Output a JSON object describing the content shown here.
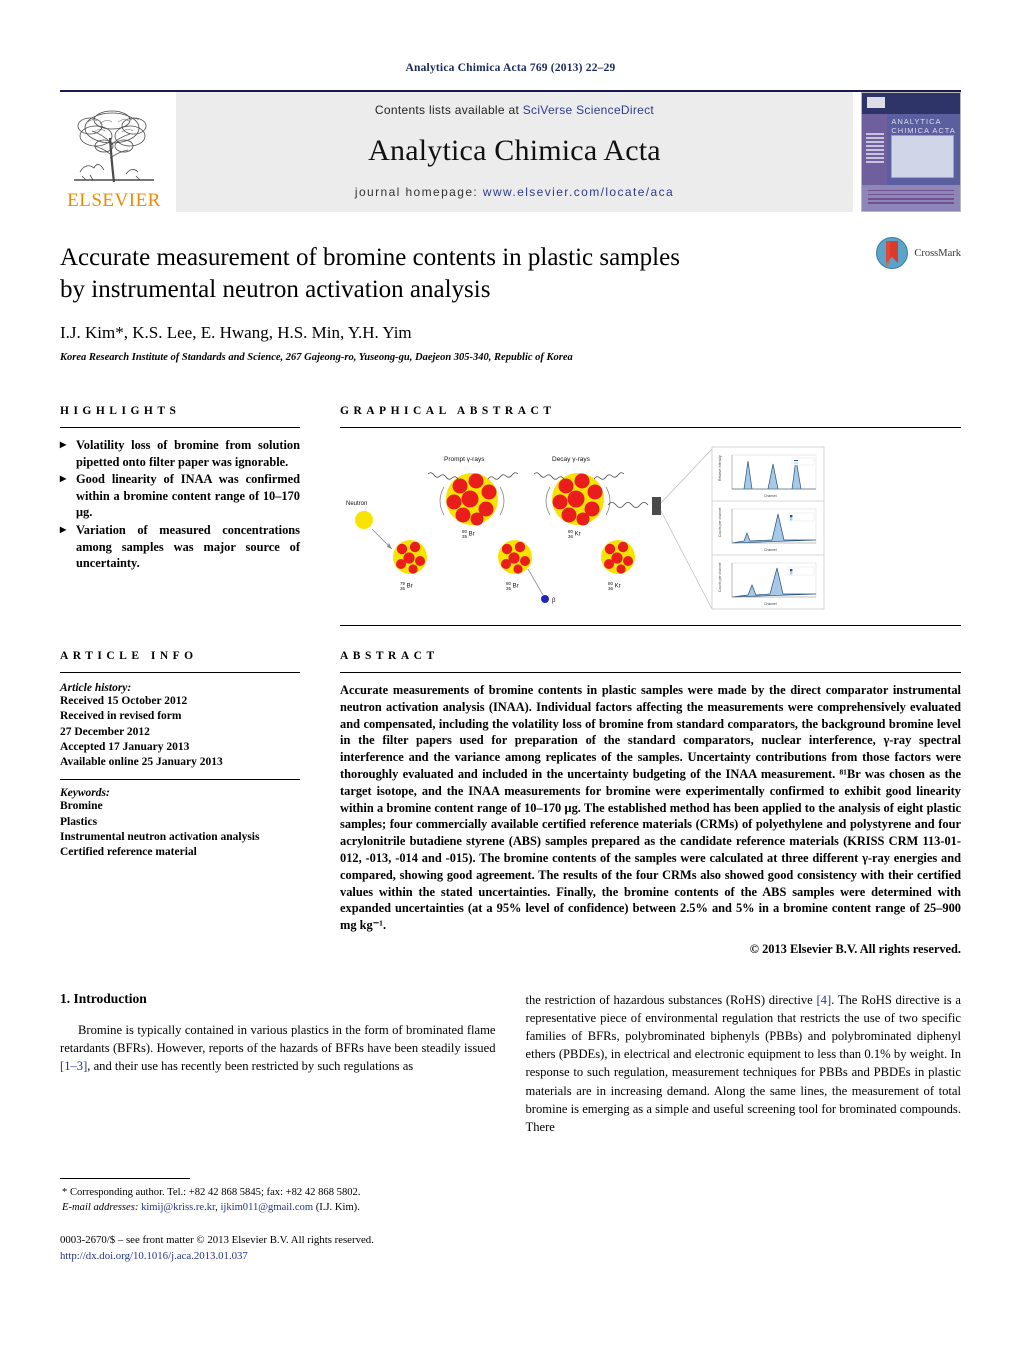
{
  "running_head": "Analytica Chimica Acta 769 (2013) 22–29",
  "masthead": {
    "publisher_name": "ELSEVIER",
    "contents_prefix": "Contents lists available at ",
    "contents_link": "SciVerse ScienceDirect",
    "journal_name": "Analytica Chimica Acta",
    "homepage_prefix": "journal homepage: ",
    "homepage_url": "www.elsevier.com/locate/aca",
    "cover_title_line1": "ANALYTICA",
    "cover_title_line2": "CHIMICA ACTA"
  },
  "article": {
    "title_line1": "Accurate measurement of bromine contents in plastic samples",
    "title_line2": "by instrumental neutron activation analysis",
    "authors": "I.J. Kim*, K.S. Lee, E. Hwang, H.S. Min, Y.H. Yim",
    "affiliation": "Korea Research Institute of Standards and Science, 267 Gajeong-ro, Yuseong-gu, Daejeon 305-340, Republic of Korea",
    "crossmark_label": "CrossMark"
  },
  "highlights": {
    "heading": "HIGHLIGHTS",
    "items": [
      "Volatility loss of bromine from solution pipetted onto filter paper was ignorable.",
      "Good linearity of INAA was confirmed within a bromine content range of 10–170 μg.",
      "Variation of measured concentrations among samples was major source of uncertainty."
    ]
  },
  "graphical_abstract": {
    "heading": "GRAPHICAL ABSTRACT",
    "labels": {
      "neutron": "Neutron",
      "prompt": "Prompt γ-rays",
      "decay": "Decay γ-rays",
      "nuclide_compound_br80": "⁸⁰Br",
      "nuclide_compound_kr80": "⁸⁰Kr",
      "nuclide_br79": "⁷⁹Br",
      "nuclide_br80_bottom": "⁸⁰Br",
      "nuclide_kr80_bottom": "⁸⁰Kr",
      "beta": "β⁻"
    },
    "spectra": [
      {
        "ylabel": "Relative intensity",
        "xlabel": "Channel"
      },
      {
        "ylabel": "Counts per channel",
        "xlabel": "Channel"
      },
      {
        "ylabel": "Counts per channel",
        "xlabel": "Channel"
      }
    ]
  },
  "article_info": {
    "heading": "ARTICLE INFO",
    "history_label": "Article history:",
    "history": [
      "Received 15 October 2012",
      "Received in revised form",
      "27 December 2012",
      "Accepted 17 January 2013",
      "Available online 25 January 2013"
    ],
    "keywords_label": "Keywords:",
    "keywords": [
      "Bromine",
      "Plastics",
      "Instrumental neutron activation analysis",
      "Certified reference material"
    ]
  },
  "abstract": {
    "heading": "ABSTRACT",
    "text": "Accurate measurements of bromine contents in plastic samples were made by the direct comparator instrumental neutron activation analysis (INAA). Individual factors affecting the measurements were comprehensively evaluated and compensated, including the volatility loss of bromine from standard comparators, the background bromine level in the filter papers used for preparation of the standard comparators, nuclear interference, γ-ray spectral interference and the variance among replicates of the samples. Uncertainty contributions from those factors were thoroughly evaluated and included in the uncertainty budgeting of the INAA measurement. ⁸¹Br was chosen as the target isotope, and the INAA measurements for bromine were experimentally confirmed to exhibit good linearity within a bromine content range of 10–170 μg. The established method has been applied to the analysis of eight plastic samples; four commercially available certified reference materials (CRMs) of polyethylene and polystyrene and four acrylonitrile butadiene styrene (ABS) samples prepared as the candidate reference materials (KRISS CRM 113-01-012, -013, -014 and -015). The bromine contents of the samples were calculated at three different γ-ray energies and compared, showing good agreement. The results of the four CRMs also showed good consistency with their certified values within the stated uncertainties. Finally, the bromine contents of the ABS samples were determined with expanded uncertainties (at a 95% level of confidence) between 2.5% and 5% in a bromine content range of 25–900 mg kg⁻¹.",
    "copyright": "© 2013 Elsevier B.V. All rights reserved."
  },
  "introduction": {
    "number_title": "1. Introduction",
    "left_paragraph_start": "Bromine is typically contained in various plastics in the form of brominated flame retardants (BFRs). However, reports of the hazards of BFRs have been steadily issued ",
    "left_ref": "[1–3]",
    "left_paragraph_end": ", and their use has recently been restricted by such regulations as",
    "right_paragraph_start": "the restriction of hazardous substances (RoHS) directive ",
    "right_ref": "[4]",
    "right_paragraph_end": ". The RoHS directive is a representative piece of environmental regulation that restricts the use of two specific families of BFRs, polybrominated biphenyls (PBBs) and polybrominated diphenyl ethers (PBDEs), in electrical and electronic equipment to less than 0.1% by weight. In response to such regulation, measurement techniques for PBBs and PBDEs in plastic materials are in increasing demand. Along the same lines, the measurement of total bromine is emerging as a simple and useful screening tool for brominated compounds. There"
  },
  "footnote": {
    "corresponding": "* Corresponding author. Tel.: +82 42 868 5845; fax: +82 42 868 5802.",
    "email_label": "E-mail addresses:",
    "email_1": "kimij@kriss.re.kr",
    "email_sep": ", ",
    "email_2": "ijkim011@gmail.com",
    "email_author": " (I.J. Kim)."
  },
  "imprint": {
    "line1": "0003-2670/$ – see front matter © 2013 Elsevier B.V. All rights reserved.",
    "doi": "http://dx.doi.org/10.1016/j.aca.2013.01.037"
  },
  "colors": {
    "link": "#26348b",
    "elsevier_orange": "#ed8b00",
    "runhead_navy": "#1a2a5e",
    "band_gray": "#ececec"
  }
}
